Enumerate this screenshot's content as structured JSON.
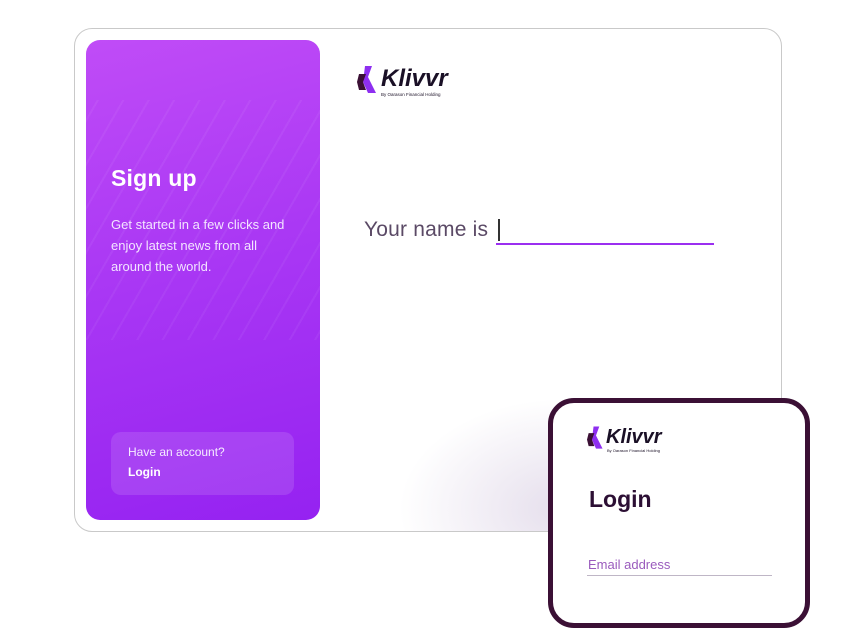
{
  "signup_panel": {
    "title": "Sign up",
    "description": "Get started in a few clicks and enjoy latest news from all around the world.",
    "account_question": "Have an account?",
    "login_link": "Login"
  },
  "brand": {
    "name": "Klivvr",
    "tagline": "By Oarason Financial Holding",
    "primary_color": "#9b2ff0",
    "dark_color": "#3b1035"
  },
  "main_form": {
    "name_label": "Your name is",
    "name_value": ""
  },
  "phone_preview": {
    "title": "Login",
    "email_placeholder": "Email address"
  }
}
